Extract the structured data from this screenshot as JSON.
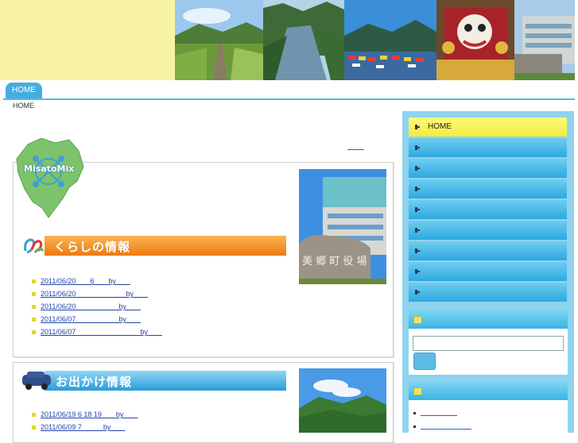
{
  "nav": {
    "home_tab": "HOME"
  },
  "breadcrumb": "HOME",
  "logo_text": "MisatoMix",
  "sections": [
    {
      "title": "くらしの情報",
      "items": [
        "2011/06/20　　6　　by　　",
        "2011/06/20　　　　　　　by　　",
        "2011/06/20　　　　　　by　　",
        "2011/06/07　　　　　　by　　",
        "2011/06/07　　　　　　　　　by　　"
      ]
    },
    {
      "title": "お出かけ情報",
      "items": [
        "2011/06/19 6 18  19　　by　　",
        "2011/06/09 7　　　by　　"
      ]
    }
  ],
  "sidebar": {
    "menu": [
      "HOME",
      "",
      "",
      "",
      "",
      "",
      "",
      "",
      ""
    ],
    "search_value": ""
  },
  "colors": {
    "accent": "#45aee0",
    "header_yellow": "#f7f3a2",
    "banner_orange": "#f08a1e",
    "banner_blue": "#3aa6dc"
  }
}
